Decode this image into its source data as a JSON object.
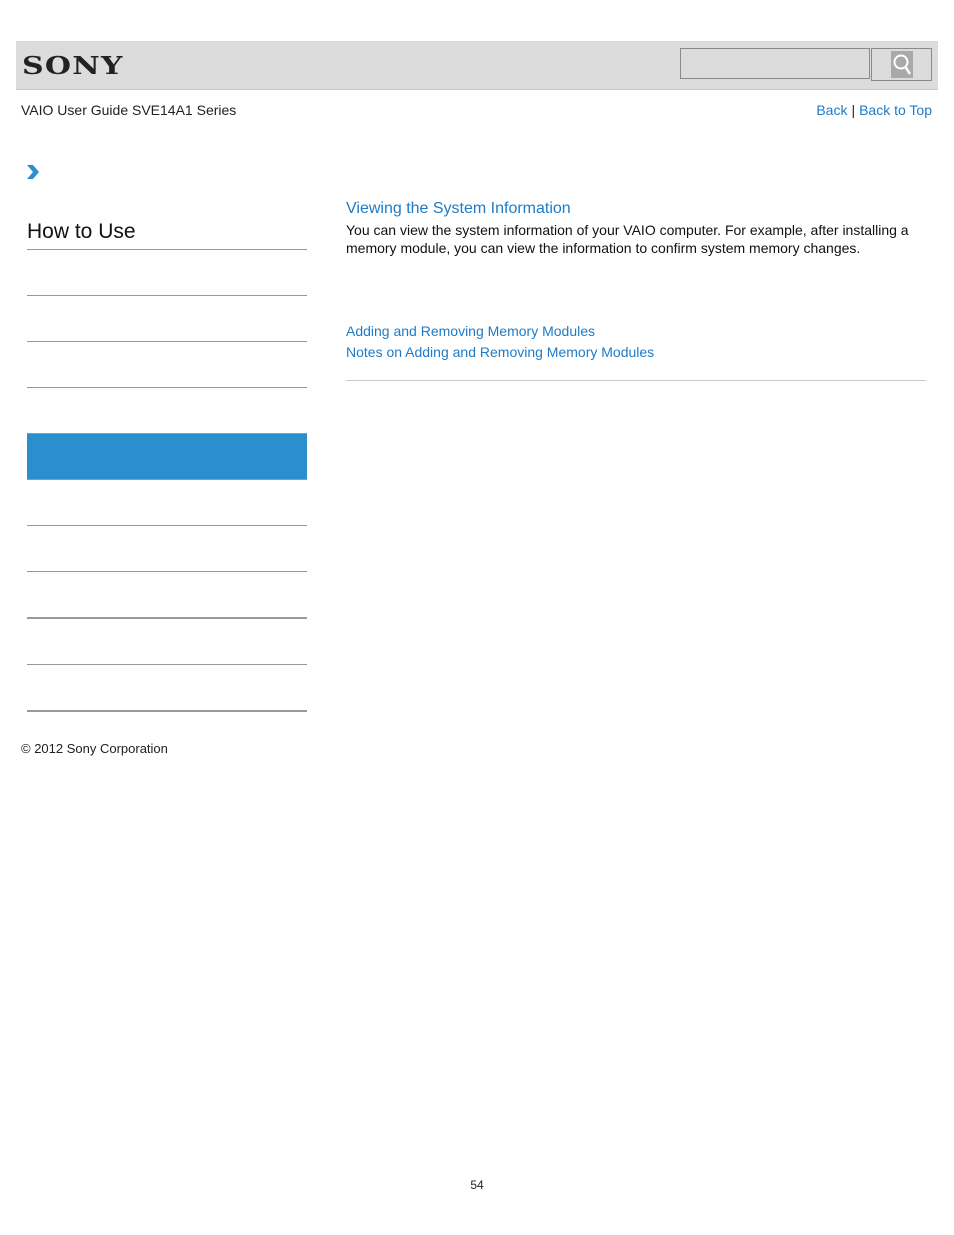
{
  "header": {
    "logo": "SONY",
    "search": {
      "placeholder": "",
      "value": "",
      "button_icon": "magnifier-icon"
    }
  },
  "subheader": {
    "guide_title": "VAIO User Guide SVE14A1 Series",
    "back_label": "Back",
    "separator": "|",
    "back_to_top_label": "Back to Top"
  },
  "breadcrumb": {
    "icon": "chevron-right-icon"
  },
  "sidebar": {
    "title": "How to Use",
    "items": [
      {
        "label": "",
        "active": false
      },
      {
        "label": "",
        "active": false
      },
      {
        "label": "",
        "active": false
      },
      {
        "label": "",
        "active": false
      },
      {
        "label": "",
        "active": true
      },
      {
        "label": "",
        "active": false
      },
      {
        "label": "",
        "active": false
      },
      {
        "label": "",
        "active": false
      },
      {
        "label": "",
        "active": false
      },
      {
        "label": "",
        "active": false
      }
    ]
  },
  "main": {
    "title": "Viewing the System Information",
    "body": "You can view the system information of your VAIO computer. For example, after installing a memory module, you can view the information to confirm system memory changes.",
    "related_links": [
      "Adding and Removing Memory Modules",
      "Notes on Adding and Removing Memory Modules"
    ]
  },
  "footer": {
    "copyright": "© 2012 Sony Corporation",
    "page_number": "54"
  },
  "colors": {
    "accent": "#1e7bc7",
    "active_item": "#2a8fcc",
    "header_bg": "#dcdcdc"
  }
}
